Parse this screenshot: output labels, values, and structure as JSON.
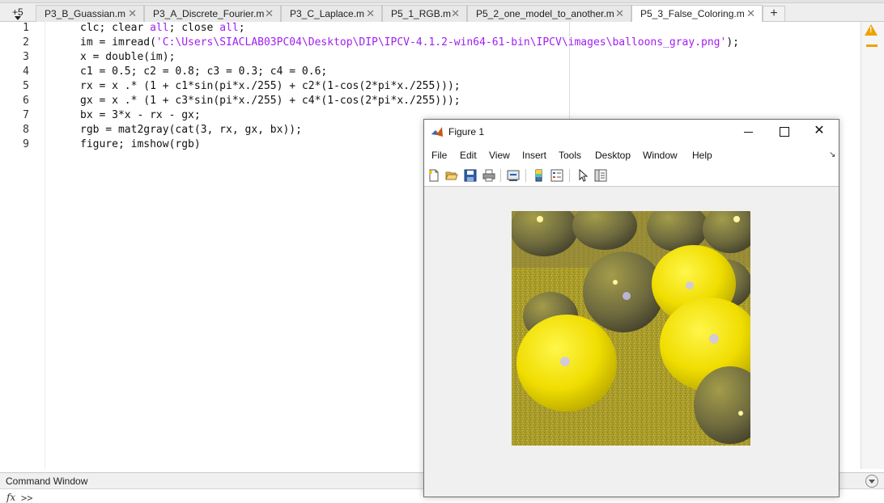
{
  "tabs": {
    "overflow_count": "+5",
    "items": [
      {
        "label": "P3_B_Guassian.m"
      },
      {
        "label": "P3_A_Discrete_Fourier.m"
      },
      {
        "label": "P3_C_Laplace.m"
      },
      {
        "label": "P5_1_RGB.m"
      },
      {
        "label": "P5_2_one_model_to_another.m"
      },
      {
        "label": "P5_3_False_Coloring.m",
        "active": true
      }
    ],
    "close_glyph": "✕",
    "add_glyph": "+"
  },
  "editor": {
    "line_numbers": [
      "1",
      "2",
      "3",
      "4",
      "5",
      "6",
      "7",
      "8",
      "9"
    ],
    "lines": [
      "clc; clear all; close all;",
      "im = imread('C:\\Users\\SIACLAB03PC04\\Desktop\\DIP\\IPCV-4.1.2-win64-61-bin\\IPCV\\images\\balloons_gray.png');",
      "x = double(im);",
      "c1 = 0.5; c2 = 0.8; c3 = 0.3; c4 = 0.6;",
      "rx = x .* (1 + c1*sin(pi*x./255) + c2*(1-cos(2*pi*x./255)));",
      "gx = x .* (1 + c3*sin(pi*x./255) + c4*(1-cos(2*pi*x./255)));",
      "bx = 3*x - rx - gx;",
      "rgb = mat2gray(cat(3, rx, gx, bx));",
      "figure; imshow(rgb)"
    ],
    "line1_parts": [
      "clc; clear ",
      "all",
      "; close ",
      "all",
      ";"
    ],
    "line2_parts": [
      "im = imread(",
      "'C:\\Users\\SIACLAB03PC04\\Desktop\\DIP\\IPCV-4.1.2-win64-61-bin\\IPCV\\images\\balloons_gray.png'",
      ");"
    ]
  },
  "command_window": {
    "title": "Command Window",
    "fx": "fx",
    "prompt": ">>"
  },
  "figure": {
    "title": "Figure 1",
    "close_glyph": "✕",
    "menus": [
      "File",
      "Edit",
      "View",
      "Insert",
      "Tools",
      "Desktop",
      "Window",
      "Help"
    ],
    "menu_overflow": "↘",
    "toolbar_icons": [
      "new-figure-icon",
      "open-file-icon",
      "save-icon",
      "print-icon",
      "link-plot-icon",
      "colorbar-icon",
      "legend-icon",
      "pointer-icon",
      "property-inspector-icon"
    ],
    "image_description_colors": {
      "background": "#a99c2a",
      "bright": "#f2e200",
      "dark": "#6b6740"
    }
  }
}
